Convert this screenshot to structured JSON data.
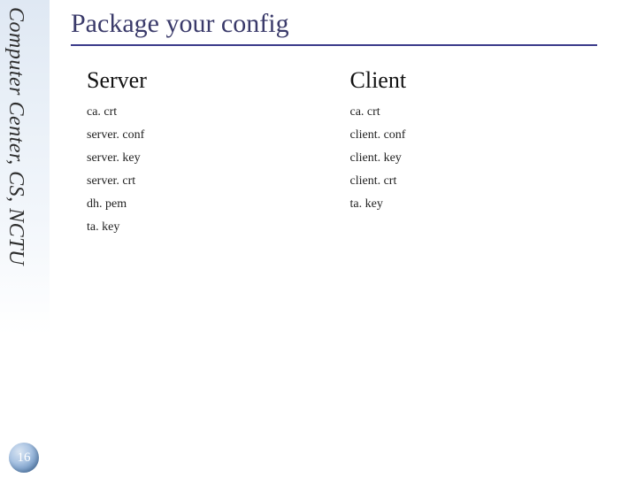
{
  "sidebar": {
    "vertical_label": "Computer Center, CS, NCTU"
  },
  "page": {
    "title": "Package your config",
    "number": "16"
  },
  "columns": {
    "server": {
      "heading": "Server",
      "files": [
        "ca. crt",
        "server. conf",
        "server. key",
        "server. crt",
        "dh. pem",
        "ta. key"
      ]
    },
    "client": {
      "heading": "Client",
      "files": [
        "ca. crt",
        "client. conf",
        "client. key",
        "client. crt",
        "ta. key"
      ]
    }
  }
}
